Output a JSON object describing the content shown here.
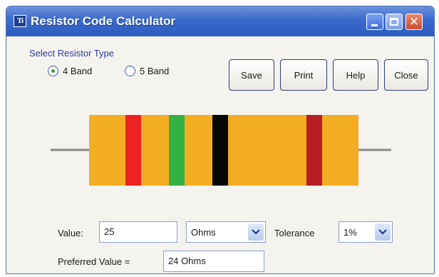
{
  "window": {
    "title": "Resistor Code Calculator"
  },
  "resistor_type": {
    "label": "Select Resistor Type",
    "options": [
      {
        "label": "4 Band",
        "selected": true
      },
      {
        "label": "5 Band",
        "selected": false
      }
    ]
  },
  "buttons": {
    "save": "Save",
    "print": "Print",
    "help": "Help",
    "close": "Close"
  },
  "resistor": {
    "body_color": "#f2ad23",
    "lead_color": "#8a8a8a",
    "bands": [
      {
        "name": "red",
        "color": "#ee2121"
      },
      {
        "name": "green",
        "color": "#35b144"
      },
      {
        "name": "black",
        "color": "#050505"
      },
      {
        "name": "brown",
        "color": "#b81e24"
      }
    ]
  },
  "form": {
    "value_label": "Value:",
    "value": "25",
    "units": "Ohms",
    "tolerance_label": "Tolerance",
    "tolerance": "1%",
    "preferred_label": "Preferred Value =",
    "preferred_value": "24 Ohms"
  }
}
